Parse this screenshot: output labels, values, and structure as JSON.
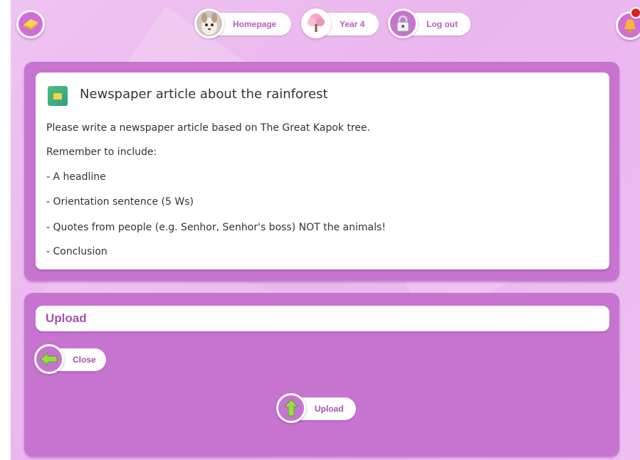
{
  "topbar": {
    "nav": [
      {
        "label": "Homepage",
        "icon": "avatar-photo-icon"
      },
      {
        "label": "Year 4",
        "icon": "pink-tree-icon"
      },
      {
        "label": "Log out",
        "icon": "padlock-icon"
      }
    ],
    "eraser_icon": "eraser-icon",
    "bell_icon": "bell-icon"
  },
  "task": {
    "title": "Newspaper article about the rainforest",
    "lines": [
      "Please write a newspaper article based on The Great Kapok tree.",
      "Remember to include:",
      "- A headline",
      "- Orientation sentence (5 Ws)",
      "- Quotes from people (e.g. Senhor, Senhor's boss) NOT the animals!",
      "- Conclusion"
    ]
  },
  "upload_section": {
    "header": "Upload",
    "close_label": "Close",
    "upload_label": "Upload"
  },
  "colors": {
    "background": "#ecbcf0",
    "panel": "#c774d0",
    "accent_text": "#a352ad",
    "badge": "#e02020"
  }
}
